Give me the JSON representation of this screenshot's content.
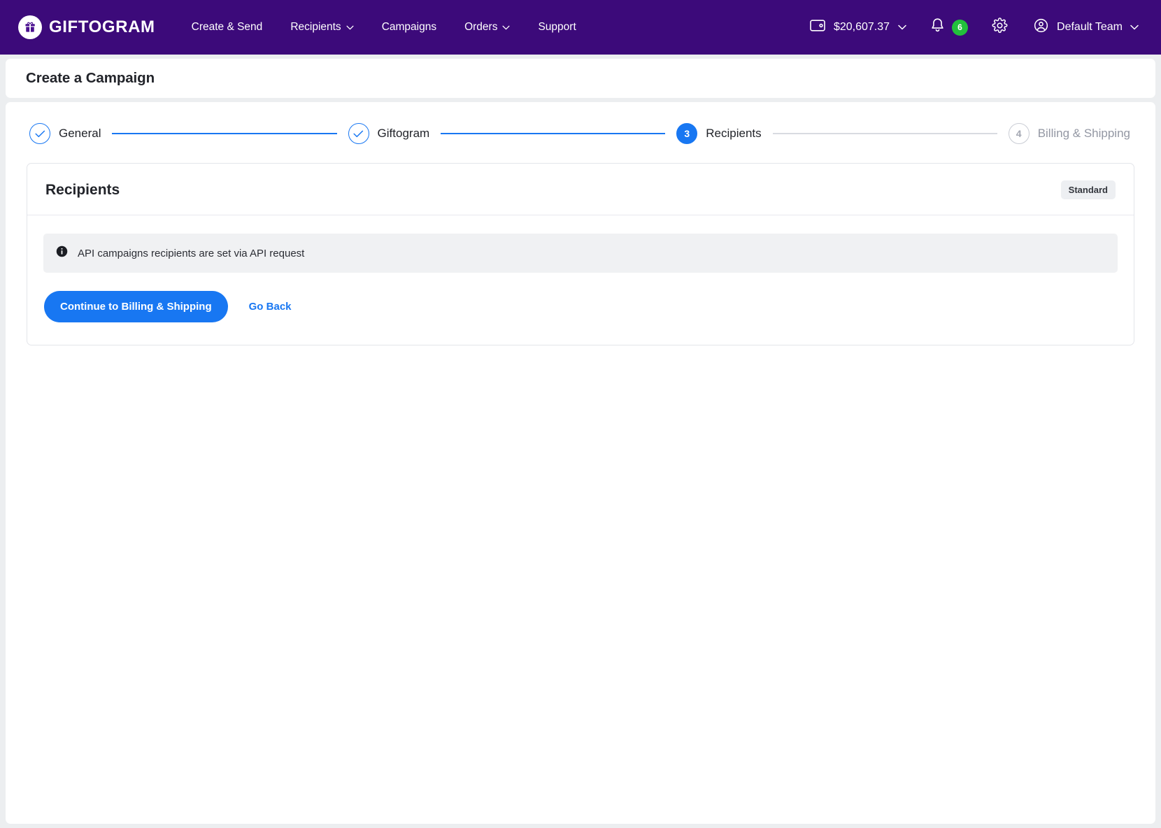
{
  "navbar": {
    "brand": {
      "name": "GIFTOGRAM",
      "icon": "gift-icon"
    },
    "links": [
      {
        "label": "Create & Send",
        "has_chevron": false
      },
      {
        "label": "Recipients",
        "has_chevron": true
      },
      {
        "label": "Campaigns",
        "has_chevron": false
      },
      {
        "label": "Orders",
        "has_chevron": true
      },
      {
        "label": "Support",
        "has_chevron": false
      }
    ],
    "wallet": {
      "icon": "wallet-icon",
      "amount": "$20,607.37",
      "has_chevron": true
    },
    "notifications": {
      "icon": "bell-icon",
      "count": "6",
      "badge_color": "#22c03c"
    },
    "settings": {
      "icon": "gear-icon"
    },
    "team": {
      "icon": "user-circle-icon",
      "name": "Default Team",
      "has_chevron": true
    },
    "background_color": "#3c0a7a"
  },
  "page": {
    "title": "Create a Campaign"
  },
  "stepper": {
    "steps": [
      {
        "number": "1",
        "label": "General",
        "state": "done",
        "glyph": "check-icon"
      },
      {
        "number": "2",
        "label": "Giftogram",
        "state": "done",
        "glyph": "check-icon"
      },
      {
        "number": "3",
        "label": "Recipients",
        "state": "active",
        "glyph": "3"
      },
      {
        "number": "4",
        "label": "Billing & Shipping",
        "state": "todo",
        "glyph": "4"
      }
    ],
    "active_color": "#1877f2",
    "idle_color": "#d8dbe1"
  },
  "card": {
    "title": "Recipients",
    "badge": "Standard",
    "alert": {
      "icon": "info-icon",
      "text": "API campaigns recipients are set via API request"
    },
    "primary_button": "Continue to Billing & Shipping",
    "secondary_button": "Go Back",
    "primary_color": "#1877f2"
  }
}
